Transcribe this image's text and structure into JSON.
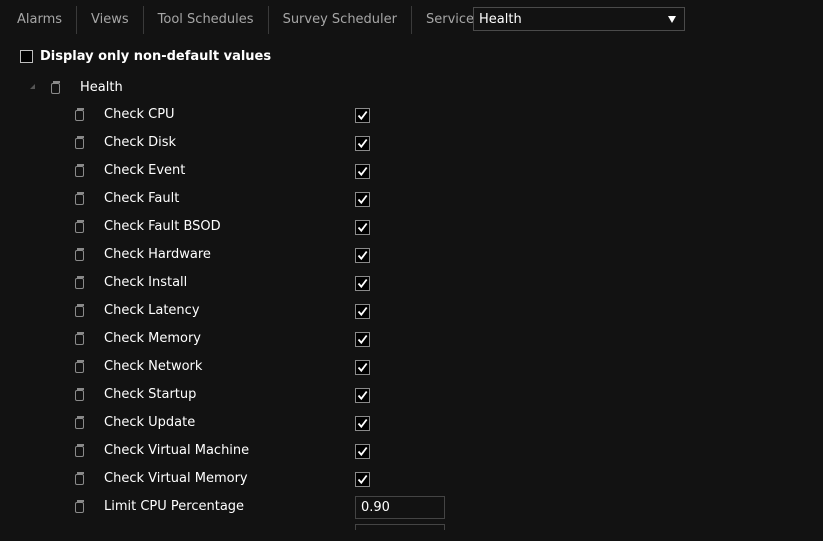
{
  "tabs": [
    {
      "label": "Alarms"
    },
    {
      "label": "Views"
    },
    {
      "label": "Tool Schedules"
    },
    {
      "label": "Survey Scheduler"
    },
    {
      "label": "Services"
    }
  ],
  "service_select": {
    "value": "Health"
  },
  "filter": {
    "label": "Display only non-default values",
    "checked": false
  },
  "tree": {
    "root_label": "Health",
    "items": [
      {
        "label": "Check CPU",
        "type": "checkbox",
        "checked": true
      },
      {
        "label": "Check Disk",
        "type": "checkbox",
        "checked": true
      },
      {
        "label": "Check Event",
        "type": "checkbox",
        "checked": true
      },
      {
        "label": "Check Fault",
        "type": "checkbox",
        "checked": true
      },
      {
        "label": "Check Fault BSOD",
        "type": "checkbox",
        "checked": true
      },
      {
        "label": "Check Hardware",
        "type": "checkbox",
        "checked": true
      },
      {
        "label": "Check Install",
        "type": "checkbox",
        "checked": true
      },
      {
        "label": "Check Latency",
        "type": "checkbox",
        "checked": true
      },
      {
        "label": "Check Memory",
        "type": "checkbox",
        "checked": true
      },
      {
        "label": "Check Network",
        "type": "checkbox",
        "checked": true
      },
      {
        "label": "Check Startup",
        "type": "checkbox",
        "checked": true
      },
      {
        "label": "Check Update",
        "type": "checkbox",
        "checked": true
      },
      {
        "label": "Check Virtual Machine",
        "type": "checkbox",
        "checked": true
      },
      {
        "label": "Check Virtual Memory",
        "type": "checkbox",
        "checked": true
      },
      {
        "label": "Limit CPU Percentage",
        "type": "number",
        "value": "0.90"
      }
    ]
  }
}
